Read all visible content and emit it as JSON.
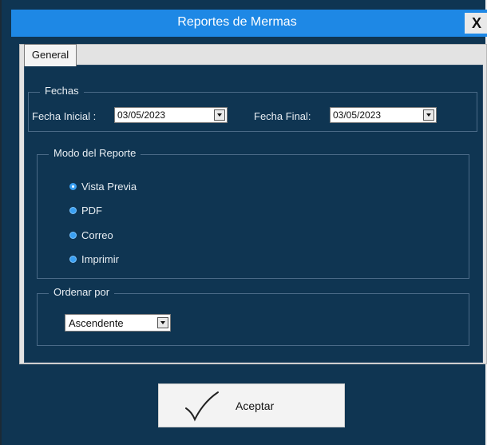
{
  "window": {
    "title": "Reportes de Mermas",
    "close_label": "X"
  },
  "tabs": [
    {
      "label": "General"
    }
  ],
  "fechas": {
    "legend": "Fechas",
    "fecha_inicial_label": "Fecha Inicial :",
    "fecha_inicial_value": "03/05/2023",
    "fecha_final_label": "Fecha Final:",
    "fecha_final_value": "03/05/2023"
  },
  "modo": {
    "legend": "Modo del  Reporte",
    "options": [
      {
        "label": "Vista Previa",
        "selected": true
      },
      {
        "label": "PDF",
        "selected": false
      },
      {
        "label": "Correo",
        "selected": false
      },
      {
        "label": "Imprimir",
        "selected": false
      }
    ]
  },
  "ordenar": {
    "legend": "Ordenar por",
    "selected": "Ascendente"
  },
  "actions": {
    "aceptar_label": "Aceptar"
  },
  "colors": {
    "titlebar": "#1e88e5",
    "background": "#0f3552",
    "radio": "#3aa0f2"
  }
}
